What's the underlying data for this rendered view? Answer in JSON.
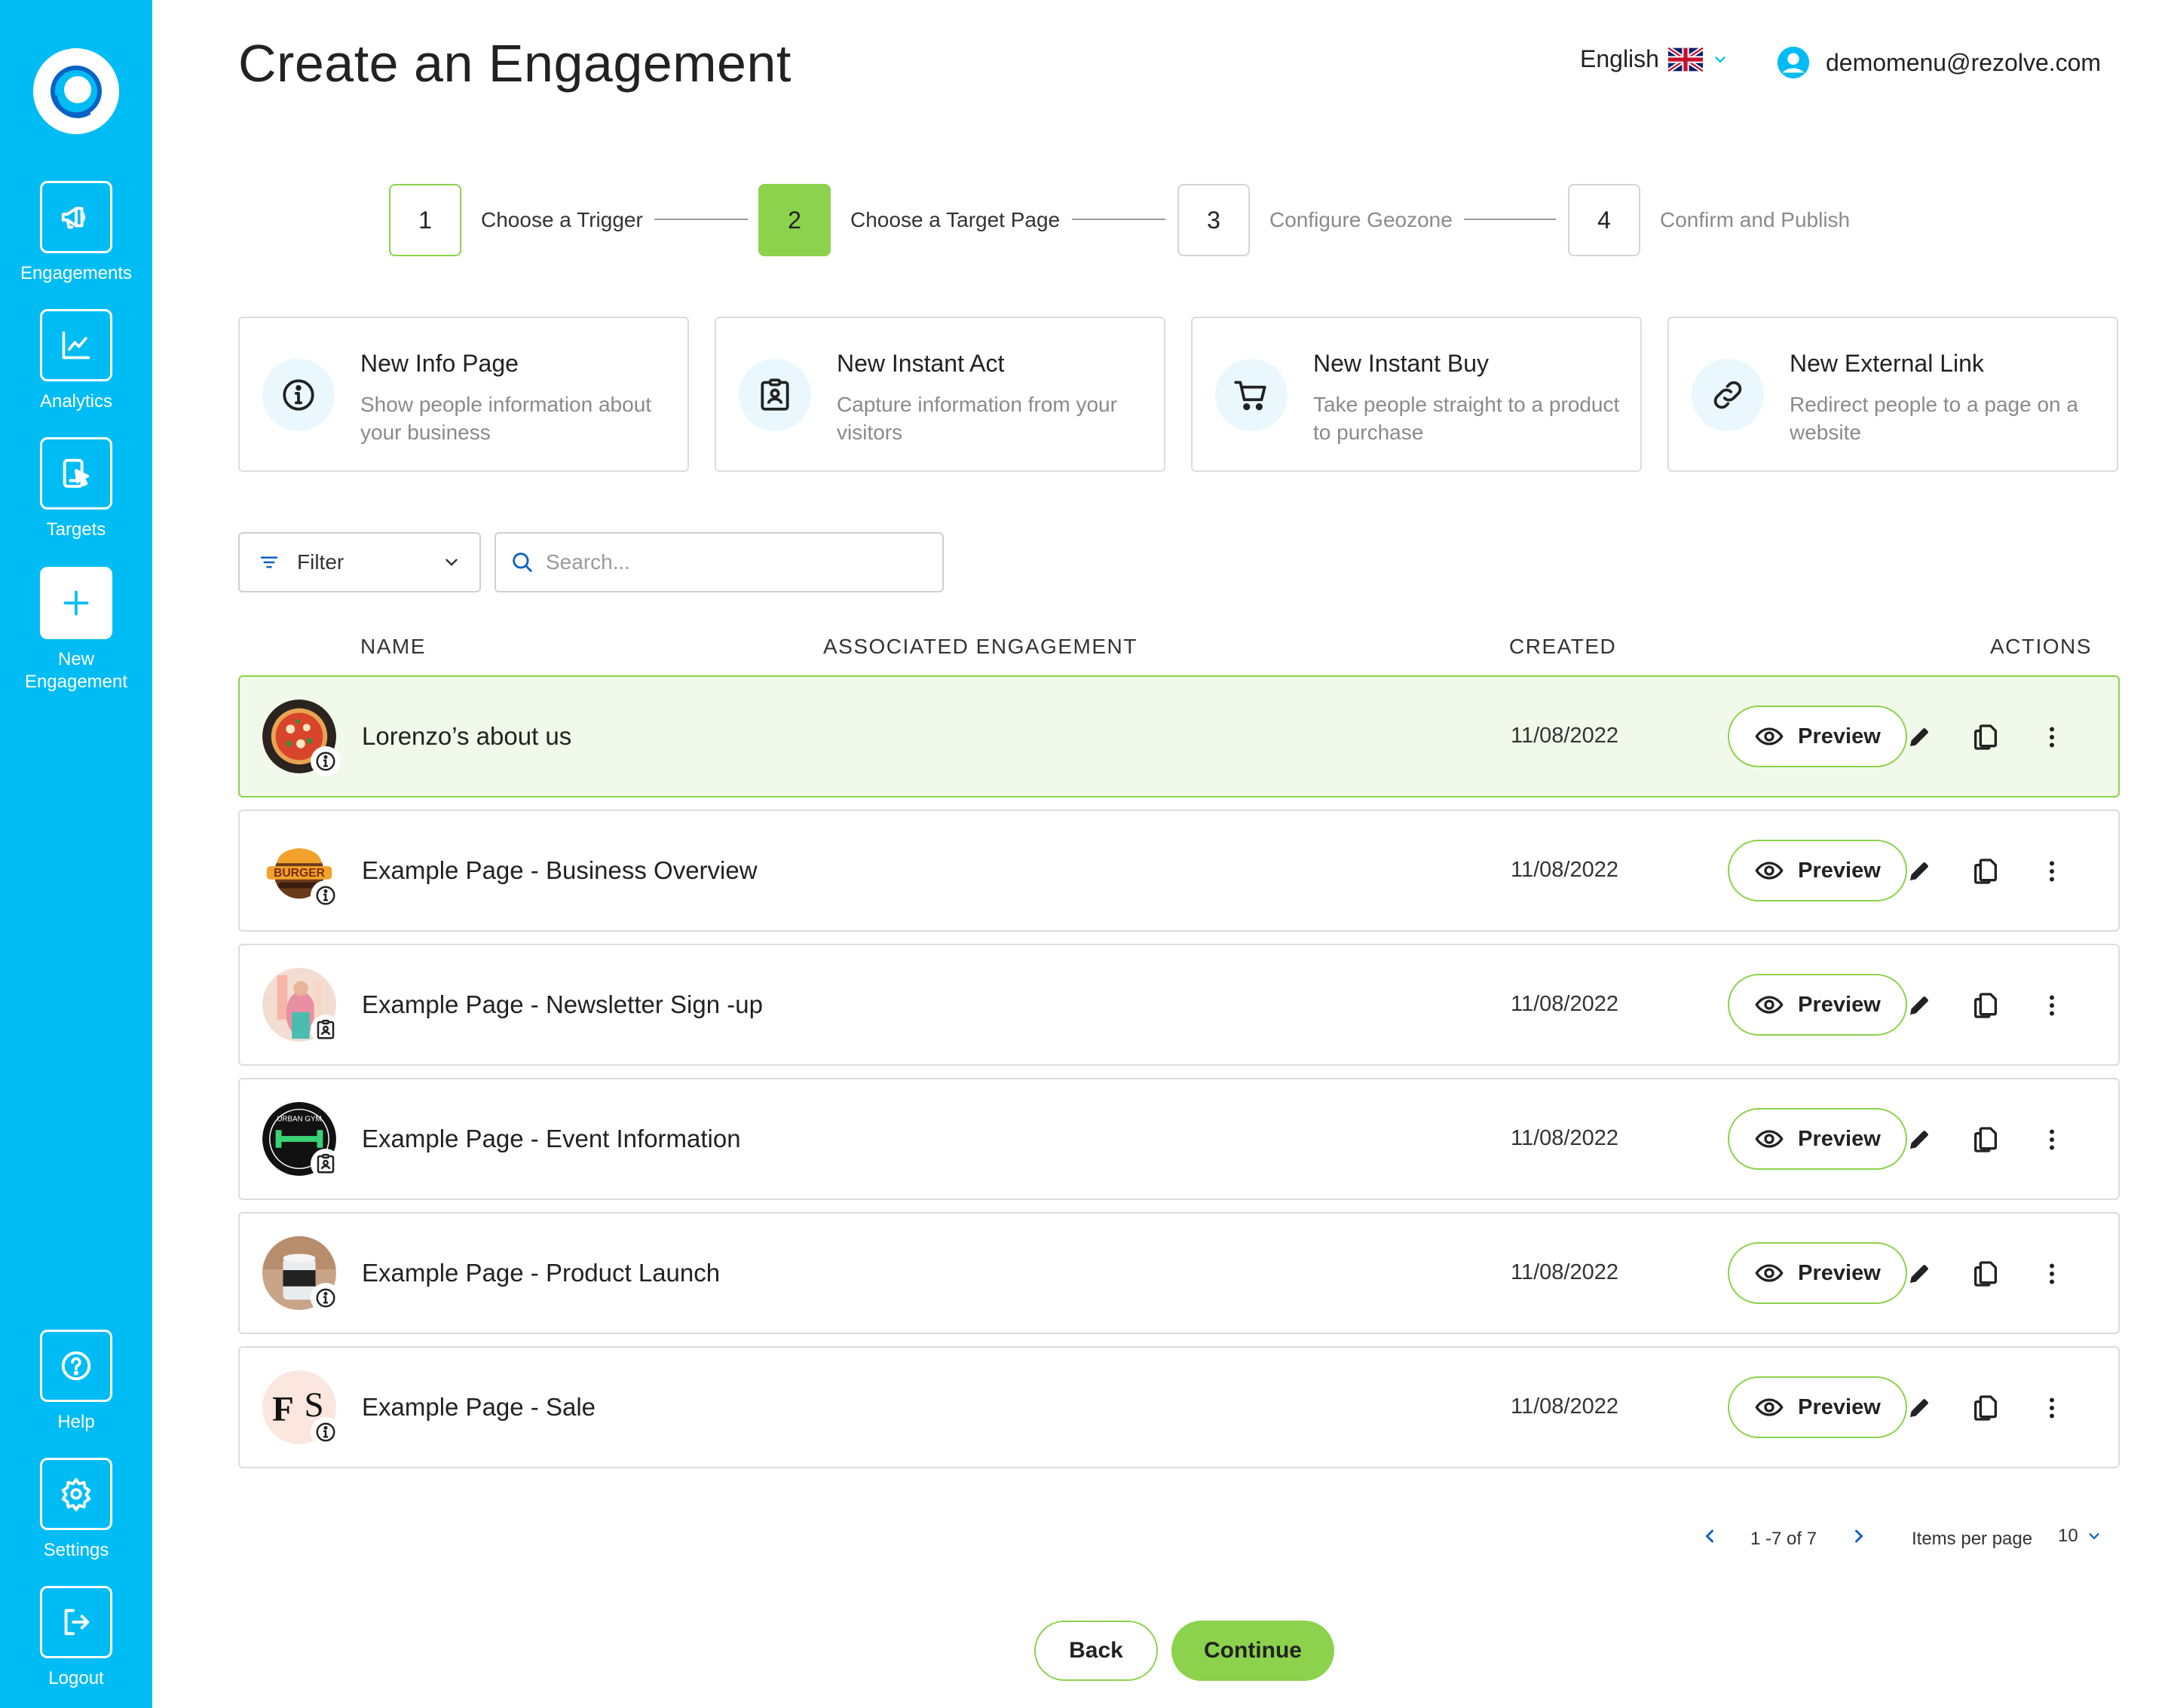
{
  "sidebar": {
    "items": [
      {
        "label": "Engagements",
        "icon": "megaphone-icon"
      },
      {
        "label": "Analytics",
        "icon": "chart-icon"
      },
      {
        "label": "Targets",
        "icon": "target-page-icon"
      },
      {
        "label": "New Engagement",
        "icon": "plus-icon"
      },
      {
        "label": "Help",
        "icon": "help-icon"
      },
      {
        "label": "Settings",
        "icon": "gear-icon"
      },
      {
        "label": "Logout",
        "icon": "logout-icon"
      }
    ]
  },
  "header": {
    "title": "Create an Engagement",
    "language": "English",
    "user_email": "demomenu@rezolve.com"
  },
  "stepper": [
    {
      "number": "1",
      "label": "Choose a Trigger",
      "state": "done"
    },
    {
      "number": "2",
      "label": "Choose a Target Page",
      "state": "active"
    },
    {
      "number": "3",
      "label": "Configure Geozone",
      "state": "pending"
    },
    {
      "number": "4",
      "label": "Confirm and Publish",
      "state": "pending"
    }
  ],
  "cards": [
    {
      "title": "New Info Page",
      "description": "Show people information about your business",
      "icon": "info-icon"
    },
    {
      "title": "New Instant Act",
      "description": "Capture information from your visitors",
      "icon": "clipboard-user-icon"
    },
    {
      "title": "New Instant Buy",
      "description": "Take people straight to a product to purchase",
      "icon": "cart-icon"
    },
    {
      "title": "New External Link",
      "description": "Redirect people to a page on a website",
      "icon": "link-icon"
    }
  ],
  "filter": {
    "label": "Filter"
  },
  "search": {
    "placeholder": "Search..."
  },
  "table": {
    "columns": [
      "NAME",
      "ASSOCIATED ENGAGEMENT",
      "CREATED",
      "ACTIONS"
    ],
    "rows": [
      {
        "name": "Lorenzo’s about us",
        "engagement": "",
        "created": "11/08/2022",
        "type": "info",
        "thumb": "pizza",
        "selected": true
      },
      {
        "name": "Example Page - Business Overview",
        "engagement": "",
        "created": "11/08/2022",
        "type": "info",
        "thumb": "burger",
        "selected": false
      },
      {
        "name": "Example Page - Newsletter Sign -up",
        "engagement": "",
        "created": "11/08/2022",
        "type": "act",
        "thumb": "newsletter",
        "selected": false
      },
      {
        "name": "Example Page - Event Information",
        "engagement": "",
        "created": "11/08/2022",
        "type": "act",
        "thumb": "gym",
        "selected": false
      },
      {
        "name": "Example Page - Product Launch",
        "engagement": "",
        "created": "11/08/2022",
        "type": "info",
        "thumb": "candle",
        "selected": false
      },
      {
        "name": "Example Page - Sale",
        "engagement": "",
        "created": "11/08/2022",
        "type": "info",
        "thumb": "fs",
        "selected": false
      }
    ],
    "preview_label": "Preview",
    "gym_logo_text": "URBAN GYM"
  },
  "pagination": {
    "range": "1 -7 of 7",
    "items_per_page_label": "Items per page",
    "items_per_page": "10"
  },
  "footer": {
    "back_label": "Back",
    "continue_label": "Continue"
  },
  "colors": {
    "sidebar": "#00bcf5",
    "accent_green": "#8cd24c",
    "selected_row": "#f1f9ea"
  }
}
